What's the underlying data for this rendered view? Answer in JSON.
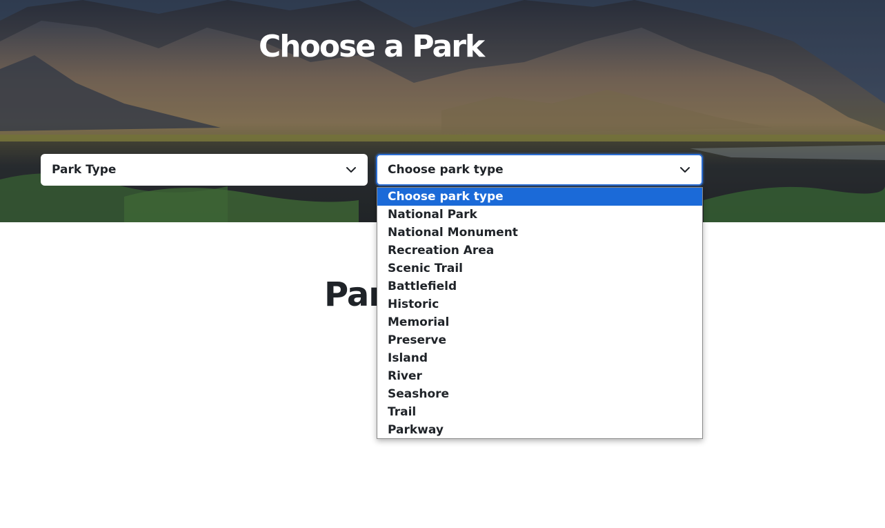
{
  "hero": {
    "title": "Choose a Park"
  },
  "filters": {
    "first_select": {
      "value": "Park Type",
      "icon": "chevron-down-icon"
    },
    "second_select": {
      "value": "Choose park type",
      "icon": "chevron-down-icon",
      "focused": true
    }
  },
  "section": {
    "title_visible": "Par"
  },
  "dropdown": {
    "selected_index": 0,
    "options": [
      {
        "label": "Choose park type"
      },
      {
        "label": "National Park"
      },
      {
        "label": "National Monument"
      },
      {
        "label": "Recreation Area"
      },
      {
        "label": "Scenic Trail"
      },
      {
        "label": "Battlefield"
      },
      {
        "label": "Historic"
      },
      {
        "label": "Memorial"
      },
      {
        "label": "Preserve"
      },
      {
        "label": "Island"
      },
      {
        "label": "River"
      },
      {
        "label": "Seashore"
      },
      {
        "label": "Trail"
      },
      {
        "label": "Parkway"
      }
    ]
  },
  "colors": {
    "accent": "#1b6ad8",
    "focus_border": "#2c6ed4",
    "text_dark": "#1f2328",
    "hero_text": "#ffffff"
  }
}
